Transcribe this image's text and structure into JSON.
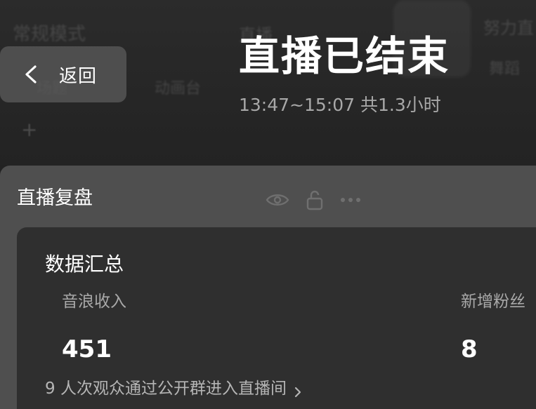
{
  "background": {
    "mode_label": "常规模式",
    "tab_one": "场题",
    "tab_two": "动画台",
    "tab_three": "直播",
    "right_top": "努力直",
    "right_bottom": "舞蹈"
  },
  "header": {
    "back_label": "返回",
    "title": "直播已结束",
    "time_range": "13:47~15:07 共1.3小时"
  },
  "review": {
    "title": "直播复盘",
    "summary": {
      "title": "数据汇总",
      "metrics": [
        {
          "label": "音浪收入",
          "value": "451"
        },
        {
          "label": "新增粉丝",
          "value": "8"
        }
      ],
      "group_link": "9 人次观众通过公开群进入直播间"
    }
  },
  "colors": {
    "background": "#222222",
    "panel": "#4f4f4f",
    "card": "#2f2f2f",
    "primary_text": "#ffffff",
    "secondary_text": "#a9a9a9"
  },
  "icons": {
    "back": "chevron-left-icon",
    "link": "chevron-right-icon",
    "ghost": [
      "eye-icon",
      "lock-icon",
      "more-icon"
    ]
  }
}
